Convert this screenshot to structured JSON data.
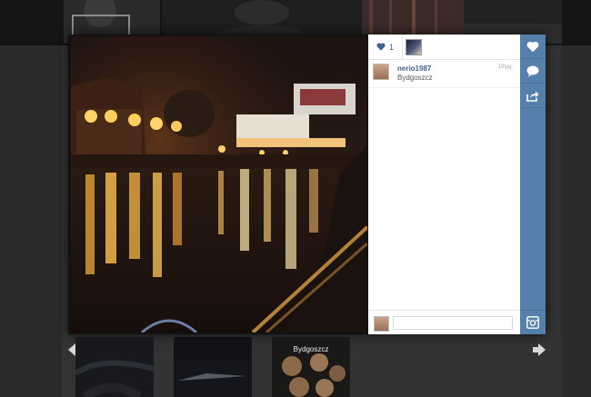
{
  "post": {
    "like_count": "1",
    "comment": {
      "username": "nerio1987",
      "time": "19tyg.",
      "text": "Bydgoszcz"
    },
    "comment_input_placeholder": ""
  },
  "actions": [
    "like-icon",
    "comment-icon",
    "share-icon",
    "instagram-icon"
  ],
  "nav": {
    "prev_icon": "arrow-left-icon",
    "next_icon": "arrow-right-icon"
  },
  "thumbnails": [
    {
      "label": ""
    },
    {
      "label": ""
    },
    {
      "label": "Bydgoszcz"
    }
  ],
  "colors": {
    "accent": "#5580ab",
    "username": "#3f6591",
    "overlay": "#2b2b2b"
  }
}
